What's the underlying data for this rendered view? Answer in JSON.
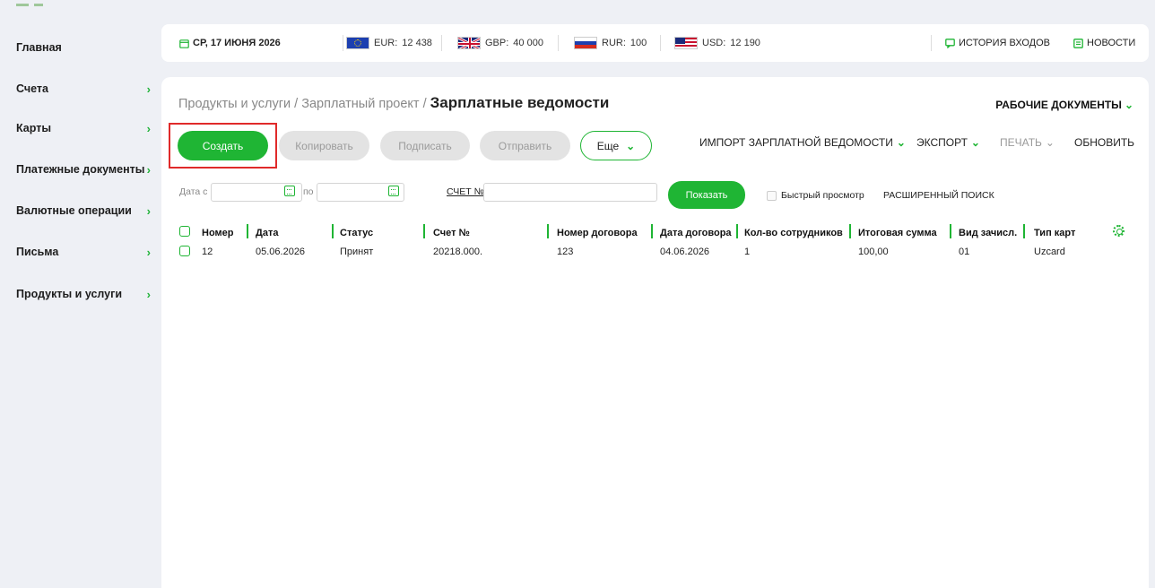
{
  "sidebar": {
    "items": [
      {
        "label": "Главная",
        "chevron": false
      },
      {
        "label": "Счета",
        "chevron": true
      },
      {
        "label": "Карты",
        "chevron": true
      },
      {
        "label": "Платежные документы",
        "chevron": true
      },
      {
        "label": "Валютные операции",
        "chevron": true
      },
      {
        "label": "Письма",
        "chevron": true
      },
      {
        "label": "Продукты и услуги",
        "chevron": true
      }
    ]
  },
  "topbar": {
    "date": "СР, 17 ИЮНЯ 2026",
    "currencies": [
      {
        "code": "EUR:",
        "value": "12 438"
      },
      {
        "code": "GBP:",
        "value": "40 000"
      },
      {
        "code": "RUR:",
        "value": "100"
      },
      {
        "code": "USD:",
        "value": "12 190"
      }
    ],
    "login_history": "ИСТОРИЯ ВХОДОВ",
    "news": "НОВОСТИ"
  },
  "breadcrumb": {
    "part1": "Продукты и услуги",
    "sep": "/",
    "part2": "Зарплатный проект",
    "current": "Зарплатные ведомости"
  },
  "work_docs": "РАБОЧИЕ ДОКУМЕНТЫ",
  "toolbar": {
    "create": "Создать",
    "copy": "Копировать",
    "sign": "Подписать",
    "send": "Отправить",
    "more": "Еще",
    "import": "ИМПОРТ ЗАРПЛАТНОЙ ВЕДОМОСТИ",
    "export": "ЭКСПОРТ",
    "print": "ПЕЧАТЬ",
    "refresh": "ОБНОВИТЬ"
  },
  "filters": {
    "date_from_label": "Дата с",
    "date_to_label": "по",
    "account_label": "СЧЕТ №",
    "show": "Показать",
    "quick_view": "Быстрый просмотр",
    "advanced_search": "РАСШИРЕННЫЙ ПОИСК"
  },
  "table": {
    "headers": [
      "Номер",
      "Дата",
      "Статус",
      "Счет №",
      "Номер договора",
      "Дата договора",
      "Кол-во сотрудников",
      "Итоговая сумма",
      "Вид зачисл.",
      "Тип карт"
    ],
    "rows": [
      [
        "12",
        "05.06.2026",
        "Принят",
        "20218.000.",
        "123",
        "04.06.2026",
        "1",
        "100,00",
        "01",
        "Uzcard"
      ]
    ]
  },
  "colors": {
    "accent": "#1fb534",
    "highlight": "#e02a2a",
    "background": "#eef0f5"
  }
}
